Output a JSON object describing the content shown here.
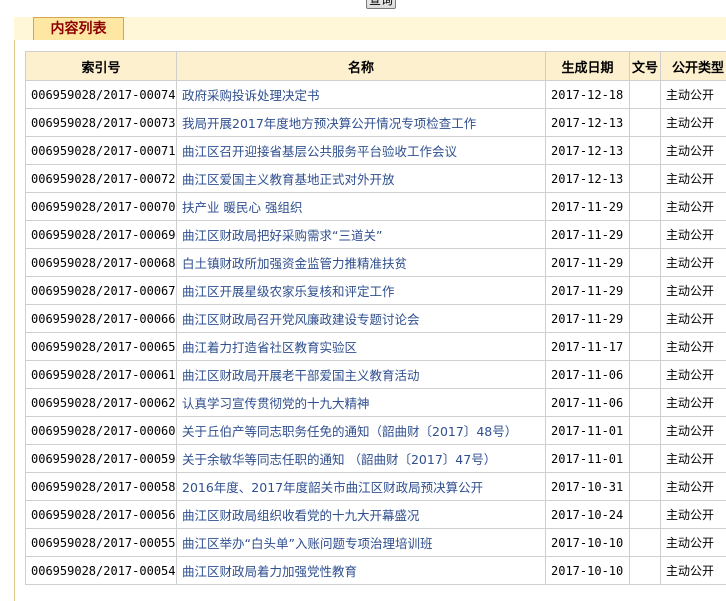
{
  "query_button": "查询",
  "panel_title": "内容列表",
  "columns": [
    "索引号",
    "名称",
    "生成日期",
    "文号",
    "公开类型"
  ],
  "rows": [
    {
      "index": "006959028/2017-00074",
      "name": "政府采购投诉处理决定书",
      "date": "2017-12-18",
      "doc_no": "",
      "type": "主动公开"
    },
    {
      "index": "006959028/2017-00073",
      "name": "我局开展2017年度地方预决算公开情况专项检查工作",
      "date": "2017-12-13",
      "doc_no": "",
      "type": "主动公开"
    },
    {
      "index": "006959028/2017-00071",
      "name": "曲江区召开迎接省基层公共服务平台验收工作会议",
      "date": "2017-12-13",
      "doc_no": "",
      "type": "主动公开"
    },
    {
      "index": "006959028/2017-00072",
      "name": "曲江区爱国主义教育基地正式对外开放",
      "date": "2017-12-13",
      "doc_no": "",
      "type": "主动公开"
    },
    {
      "index": "006959028/2017-00070",
      "name": "扶产业 暖民心 强组织",
      "date": "2017-11-29",
      "doc_no": "",
      "type": "主动公开"
    },
    {
      "index": "006959028/2017-00069",
      "name": "曲江区财政局把好采购需求“三道关”",
      "date": "2017-11-29",
      "doc_no": "",
      "type": "主动公开"
    },
    {
      "index": "006959028/2017-00068",
      "name": "白土镇财政所加强资金监管力推精准扶贫",
      "date": "2017-11-29",
      "doc_no": "",
      "type": "主动公开"
    },
    {
      "index": "006959028/2017-00067",
      "name": "曲江区开展星级农家乐复核和评定工作",
      "date": "2017-11-29",
      "doc_no": "",
      "type": "主动公开"
    },
    {
      "index": "006959028/2017-00066",
      "name": "曲江区财政局召开党风廉政建设专题讨论会",
      "date": "2017-11-29",
      "doc_no": "",
      "type": "主动公开"
    },
    {
      "index": "006959028/2017-00065",
      "name": "曲江着力打造省社区教育实验区",
      "date": "2017-11-17",
      "doc_no": "",
      "type": "主动公开"
    },
    {
      "index": "006959028/2017-00061",
      "name": "曲江区财政局开展老干部爱国主义教育活动",
      "date": "2017-11-06",
      "doc_no": "",
      "type": "主动公开"
    },
    {
      "index": "006959028/2017-00062",
      "name": "认真学习宣传贯彻党的十九大精神",
      "date": "2017-11-06",
      "doc_no": "",
      "type": "主动公开"
    },
    {
      "index": "006959028/2017-00060",
      "name": "关于丘伯产等同志职务任免的通知（韶曲财〔2017〕48号）",
      "date": "2017-11-01",
      "doc_no": "",
      "type": "主动公开"
    },
    {
      "index": "006959028/2017-00059",
      "name": "关于余敏华等同志任职的通知 （韶曲财〔2017〕47号）",
      "date": "2017-11-01",
      "doc_no": "",
      "type": "主动公开"
    },
    {
      "index": "006959028/2017-00058",
      "name": "2016年度、2017年度韶关市曲江区财政局预决算公开",
      "date": "2017-10-31",
      "doc_no": "",
      "type": "主动公开"
    },
    {
      "index": "006959028/2017-00056",
      "name": "曲江区财政局组织收看党的十九大开幕盛况",
      "date": "2017-10-24",
      "doc_no": "",
      "type": "主动公开"
    },
    {
      "index": "006959028/2017-00055",
      "name": "曲江区举办“白头单”入账问题专项治理培训班",
      "date": "2017-10-10",
      "doc_no": "",
      "type": "主动公开"
    },
    {
      "index": "006959028/2017-00054",
      "name": "曲江区财政局着力加强党性教育",
      "date": "2017-10-10",
      "doc_no": "",
      "type": "主动公开"
    }
  ]
}
